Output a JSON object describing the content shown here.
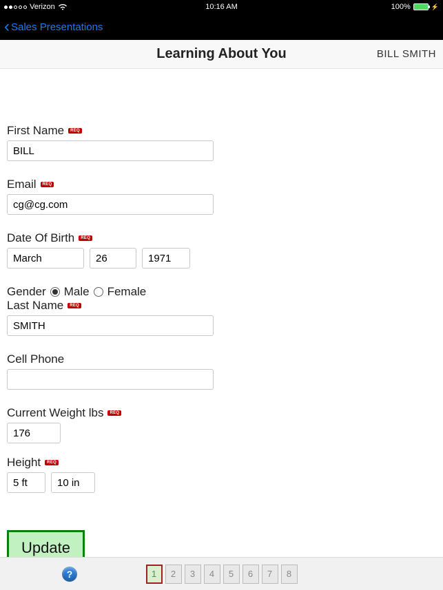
{
  "status": {
    "carrier": "Verizon",
    "time": "10:16 AM",
    "battery_pct": "100%"
  },
  "nav": {
    "back_label": "Sales Presentations"
  },
  "header": {
    "title": "Learning About You",
    "user": "BILL SMITH"
  },
  "form": {
    "first_name": {
      "label": "First Name",
      "value": "BILL",
      "req": "REQ"
    },
    "last_name": {
      "label": "Last Name",
      "value": "SMITH",
      "req": "REQ"
    },
    "email": {
      "label": "Email",
      "value": "cg@cg.com",
      "req": "REQ"
    },
    "cell": {
      "label": "Cell Phone",
      "value": ""
    },
    "dob": {
      "label": "Date Of Birth",
      "month": "March",
      "day": "26",
      "year": "1971",
      "req": "REQ"
    },
    "weight": {
      "label": "Current Weight lbs",
      "value": "176",
      "req": "REQ"
    },
    "gender": {
      "label": "Gender",
      "male": "Male",
      "female": "Female",
      "selected": "male"
    },
    "height": {
      "label": "Height",
      "ft": "5 ft",
      "in": "10 in",
      "req": "REQ"
    },
    "update_label": "Update"
  },
  "pager": {
    "pages": [
      "1",
      "2",
      "3",
      "4",
      "5",
      "6",
      "7",
      "8"
    ],
    "active": 0
  }
}
